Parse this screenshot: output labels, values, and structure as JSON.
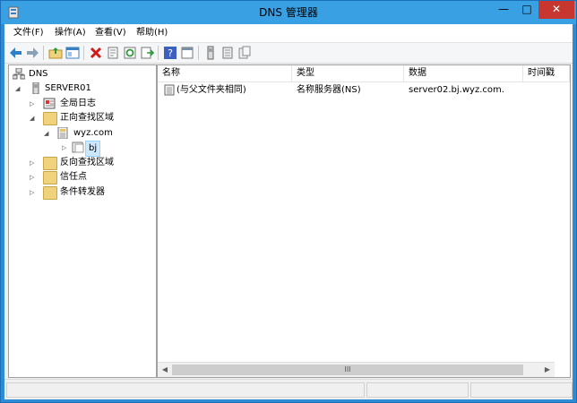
{
  "window": {
    "title": "DNS 管理器",
    "accent": "#39a0e4"
  },
  "menubar": {
    "items": [
      {
        "label": "文件(F)"
      },
      {
        "label": "操作(A)"
      },
      {
        "label": "查看(V)"
      },
      {
        "label": "帮助(H)"
      }
    ]
  },
  "toolbar": {
    "icons": [
      "back-arrow-icon",
      "forward-arrow-icon",
      "up-folder-icon",
      "show-hide-tree-icon",
      "delete-icon",
      "properties-icon",
      "refresh-icon",
      "export-list-icon",
      "help-icon",
      "console-icon",
      "server-icon",
      "zone-icon",
      "record-icon"
    ]
  },
  "tree": {
    "root": "DNS",
    "server": "SERVER01",
    "global_logs": "全局日志",
    "forward_zones": "正向查找区域",
    "zone": "wyz.com",
    "subdomain": "bj",
    "reverse_zones": "反向查找区域",
    "trust_points": "信任点",
    "conditional_forwarders": "条件转发器"
  },
  "list": {
    "columns": [
      "名称",
      "类型",
      "数据",
      "时间戳"
    ],
    "rows": [
      {
        "name": "(与父文件夹相同)",
        "type": "名称服务器(NS)",
        "data": "server02.bj.wyz.com."
      }
    ]
  },
  "scrollbar": {
    "left_arrow": "◀",
    "right_arrow": "▶",
    "grip": "III"
  }
}
